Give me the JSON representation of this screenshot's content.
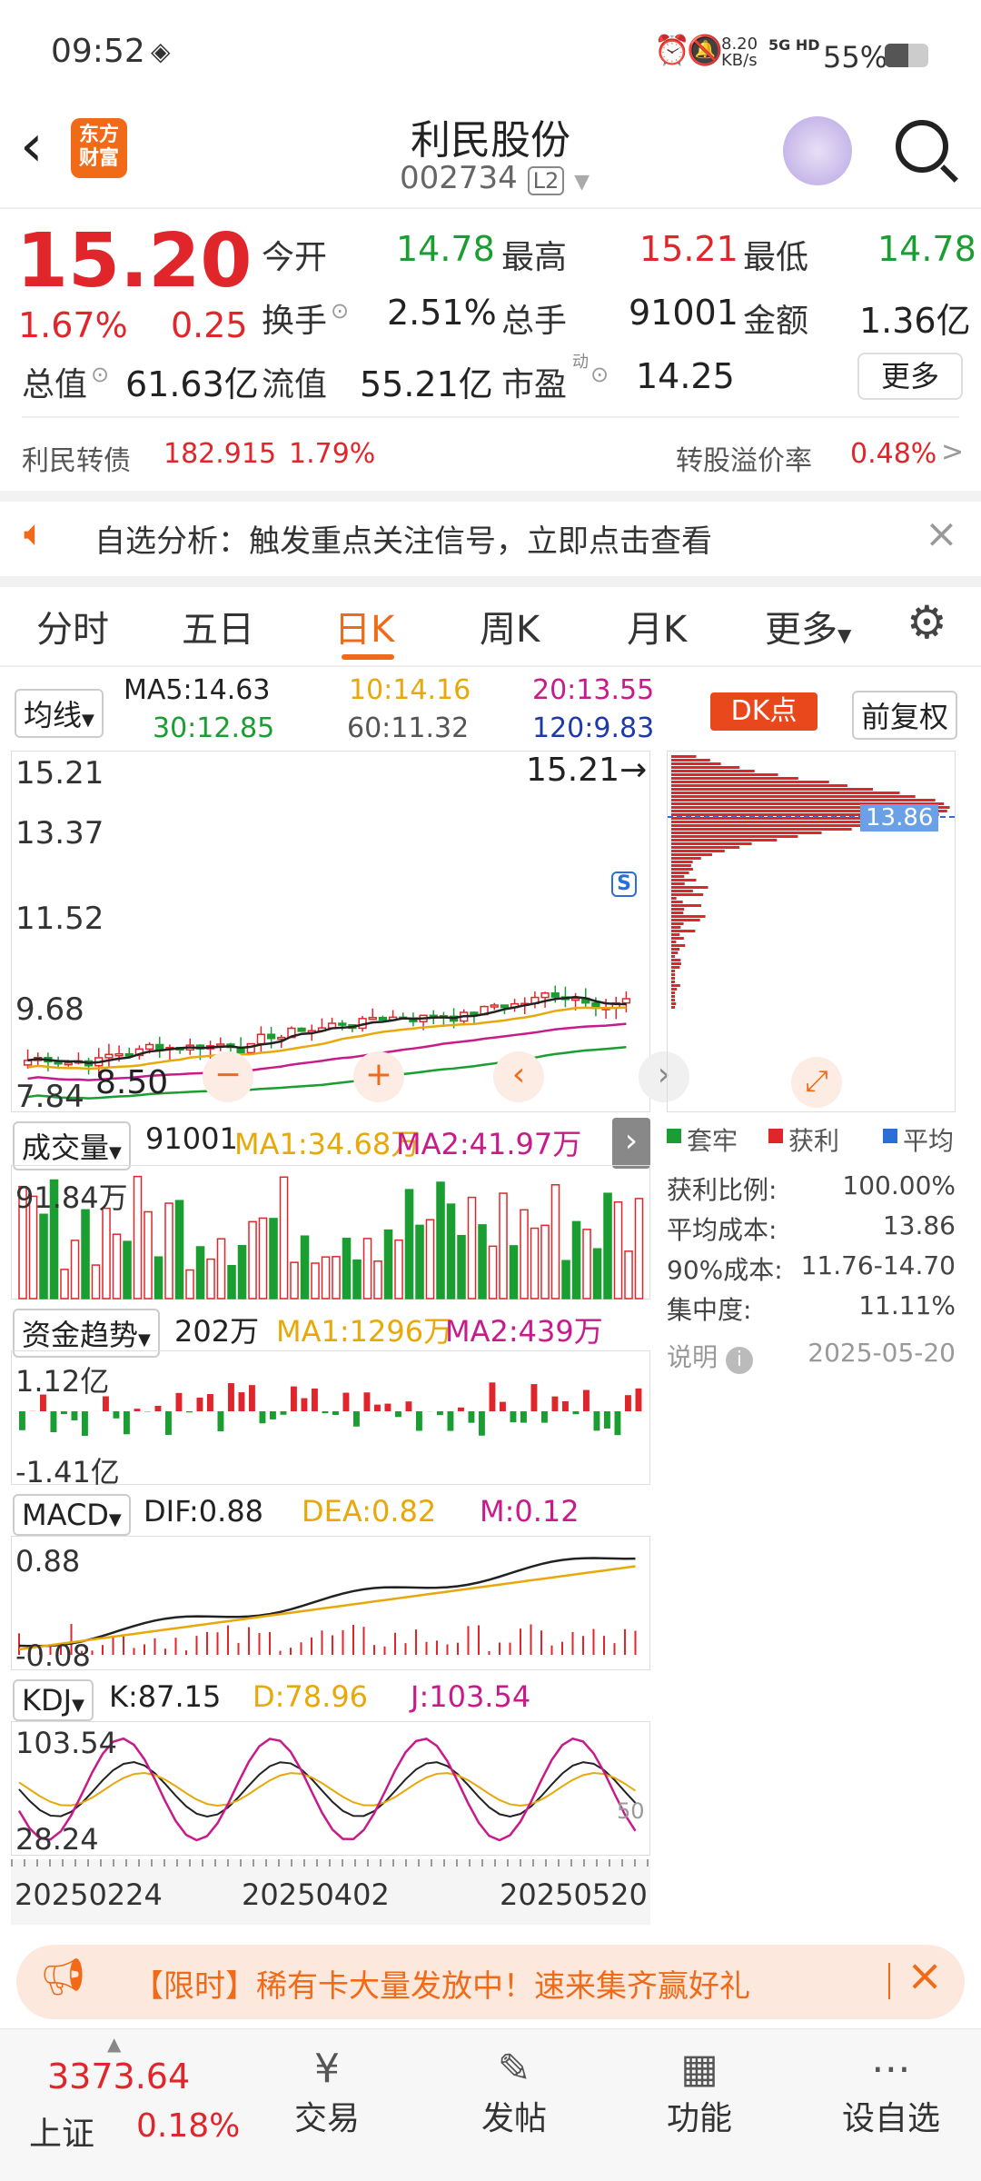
{
  "status": {
    "time": "09:52",
    "speed": "8.20",
    "speed_unit": "KB/s",
    "network": "5G HD",
    "battery": "55%"
  },
  "header": {
    "title": "利民股份",
    "code": "002734",
    "level": "L2",
    "logo_text": "东方\n财富"
  },
  "quote": {
    "price": "15.20",
    "pct": "1.67%",
    "change": "0.25",
    "open_label": "今开",
    "open": "14.78",
    "high_label": "最高",
    "high": "15.21",
    "low_label": "最低",
    "low": "14.78",
    "turnover_label": "换手",
    "turnover": "2.51%",
    "volume_label": "总手",
    "volume": "91001",
    "amount_label": "金额",
    "amount": "1.36亿",
    "mktcap_label": "总值",
    "mktcap": "61.63亿",
    "float_label": "流值",
    "float": "55.21亿",
    "pe_label": "市盈",
    "pe_sup": "动",
    "pe": "14.25",
    "more": "更多"
  },
  "bond": {
    "name": "利民转债",
    "price": "182.915",
    "pct": "1.79%",
    "premium_label": "转股溢价率",
    "premium": "0.48%"
  },
  "notice": {
    "text": "自选分析：触发重点关注信号，立即点击查看"
  },
  "tabs": [
    "分时",
    "五日",
    "日K",
    "周K",
    "月K",
    "更多"
  ],
  "active_tab": 2,
  "ma": {
    "selector": "均线",
    "ma5": "MA5:14.63",
    "ma10": "10:14.16",
    "ma20": "20:13.55",
    "ma30": "30:12.85",
    "ma60": "60:11.32",
    "ma120": "120:9.83",
    "dk": "DK点",
    "adjust": "前复权"
  },
  "kline": {
    "ticks": [
      "15.21",
      "13.37",
      "11.52",
      "9.68",
      "7.84"
    ],
    "max_label": "15.21",
    "low_label": "8.50",
    "signal_s": "S"
  },
  "chips": {
    "avg_label": "13.86",
    "legend": [
      "套牢",
      "获利",
      "平均"
    ],
    "rows": [
      {
        "k": "获利比例:",
        "v": "100.00%"
      },
      {
        "k": "平均成本:",
        "v": "13.86"
      },
      {
        "k": "90%成本:",
        "v": "11.76-14.70"
      },
      {
        "k": "集中度:",
        "v": "11.11%"
      }
    ],
    "note": "说明",
    "date": "2025-05-20"
  },
  "volume": {
    "selector": "成交量",
    "val": "91001",
    "ma1": "MA1:34.68万",
    "ma2": "MA2:41.97万",
    "max_tick": "91.84万"
  },
  "fund": {
    "selector": "资金趋势",
    "val": "202万",
    "ma1": "MA1:1296万",
    "ma2": "MA2:439万",
    "top": "1.12亿",
    "bottom": "-1.41亿"
  },
  "macd": {
    "selector": "MACD",
    "dif": "DIF:0.88",
    "dea": "DEA:0.82",
    "m": "M:0.12",
    "top": "0.88",
    "bottom": "-0.08"
  },
  "kdj": {
    "selector": "KDJ",
    "k": "K:87.15",
    "d": "D:78.96",
    "j": "J:103.54",
    "top": "103.54",
    "bottom": "28.24",
    "mid": "50"
  },
  "dates": [
    "20250224",
    "20250402",
    "20250520"
  ],
  "banner": {
    "text": "【限时】稀有卡大量发放中！速来集齐赢好礼"
  },
  "bottom": {
    "index_value": "3373.64",
    "index_name": "上证",
    "index_pct": "0.18%",
    "items": [
      "交易",
      "发帖",
      "功能",
      "设自选"
    ]
  },
  "colors": {
    "up": "#e0262b",
    "down": "#1a9e31",
    "accent": "#f06a18"
  }
}
